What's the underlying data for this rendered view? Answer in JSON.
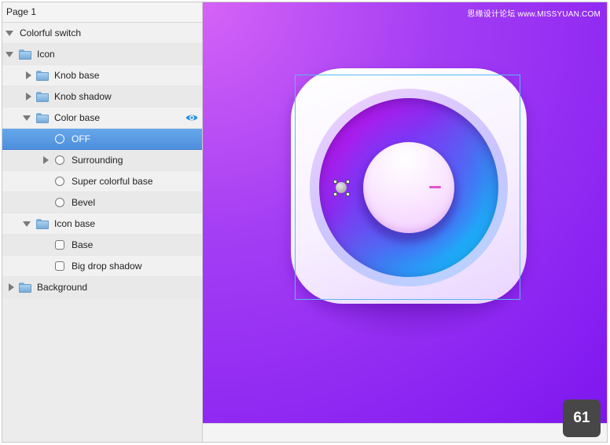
{
  "page": {
    "title": "Page 1"
  },
  "layers": [
    {
      "label": "Colorful switch",
      "type": "artboard",
      "indent": 0,
      "expanded": true
    },
    {
      "label": "Icon",
      "type": "folder",
      "indent": 0,
      "expanded": true
    },
    {
      "label": "Knob base",
      "type": "folder",
      "indent": 1,
      "expanded": false
    },
    {
      "label": "Knob shadow",
      "type": "folder",
      "indent": 1,
      "expanded": false
    },
    {
      "label": "Color base",
      "type": "folder",
      "indent": 1,
      "expanded": true,
      "visibility_icon": "eye-icon"
    },
    {
      "label": "OFF",
      "type": "oval",
      "indent": 2,
      "selected": true
    },
    {
      "label": "Surrounding",
      "type": "oval",
      "indent": 2,
      "expanded": false
    },
    {
      "label": "Super colorful base",
      "type": "oval",
      "indent": 2
    },
    {
      "label": "Bevel",
      "type": "oval",
      "indent": 2
    },
    {
      "label": "Icon base",
      "type": "folder",
      "indent": 1,
      "expanded": true
    },
    {
      "label": "Base",
      "type": "rectangle",
      "indent": 2
    },
    {
      "label": "Big drop shadow",
      "type": "rectangle",
      "indent": 2
    },
    {
      "label": "Background",
      "type": "folder",
      "indent": 0,
      "expanded": false
    }
  ],
  "canvas": {
    "watermark": "思缘设计论坛 www.MISSYUAN.COM",
    "background_colors": [
      "#d563f6",
      "#7e16f0"
    ],
    "selection_color": "#59b9f0"
  },
  "badge": {
    "number": "61"
  }
}
